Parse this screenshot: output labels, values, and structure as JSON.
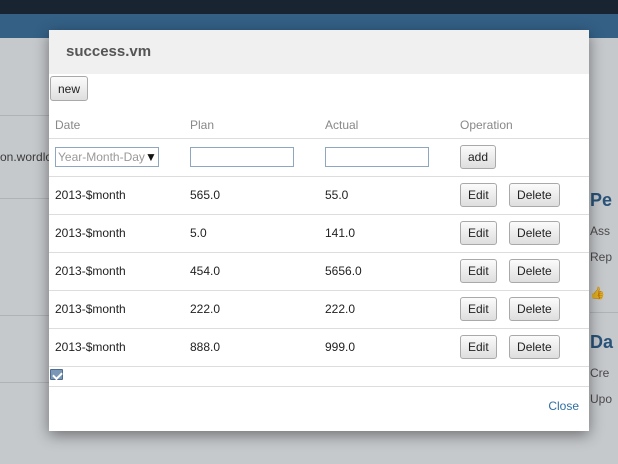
{
  "background": {
    "left_text": "on.wordlo",
    "right_items": [
      "Pe",
      "Ass",
      "Rep",
      "Da",
      "Cre",
      "Upo"
    ]
  },
  "modal": {
    "title": "success.vm",
    "new_label": "new",
    "columns": {
      "date": "Date",
      "plan": "Plan",
      "actual": "Actual",
      "operation": "Operation"
    },
    "form": {
      "date_placeholder": "Year-Month-Day",
      "add_label": "add"
    },
    "rows": [
      {
        "date": "2013-$month",
        "plan": "565.0",
        "actual": "55.0"
      },
      {
        "date": "2013-$month",
        "plan": "5.0",
        "actual": "141.0"
      },
      {
        "date": "2013-$month",
        "plan": "454.0",
        "actual": "5656.0"
      },
      {
        "date": "2013-$month",
        "plan": "222.0",
        "actual": "222.0"
      },
      {
        "date": "2013-$month",
        "plan": "888.0",
        "actual": "999.0"
      }
    ],
    "edit_label": "Edit",
    "delete_label": "Delete",
    "close_label": "Close"
  }
}
